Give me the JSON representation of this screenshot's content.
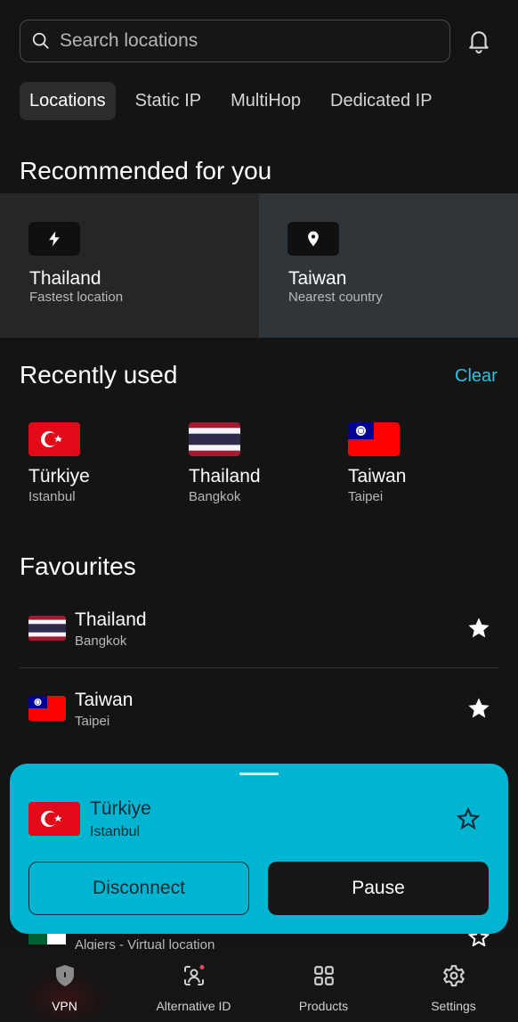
{
  "search": {
    "placeholder": "Search locations"
  },
  "tabs": [
    {
      "label": "Locations",
      "active": true
    },
    {
      "label": "Static IP"
    },
    {
      "label": "MultiHop"
    },
    {
      "label": "Dedicated IP"
    }
  ],
  "recommended": {
    "title": "Recommended for you",
    "cards": [
      {
        "name": "Thailand",
        "sub": "Fastest location",
        "icon": "bolt-icon"
      },
      {
        "name": "Taiwan",
        "sub": "Nearest country",
        "icon": "location-pin-icon"
      }
    ]
  },
  "recent": {
    "title": "Recently used",
    "clear_label": "Clear",
    "items": [
      {
        "name": "Türkiye",
        "sub": "Istanbul"
      },
      {
        "name": "Thailand",
        "sub": "Bangkok"
      },
      {
        "name": "Taiwan",
        "sub": "Taipei"
      }
    ]
  },
  "favourites": {
    "title": "Favourites",
    "items": [
      {
        "name": "Thailand",
        "sub": "Bangkok"
      },
      {
        "name": "Taiwan",
        "sub": "Taipei"
      }
    ],
    "peek_sub": "Algiers - Virtual location"
  },
  "sheet": {
    "name": "Türkiye",
    "sub": "Istanbul",
    "disconnect_label": "Disconnect",
    "pause_label": "Pause"
  },
  "nav": {
    "items": [
      {
        "label": "VPN",
        "icon": "shield-icon"
      },
      {
        "label": "Alternative ID",
        "icon": "alternative-id-icon"
      },
      {
        "label": "Products",
        "icon": "grid-icon"
      },
      {
        "label": "Settings",
        "icon": "gear-icon"
      }
    ]
  },
  "colors": {
    "accent": "#00b5d2",
    "link": "#2cc2e2",
    "background": "#141414"
  }
}
